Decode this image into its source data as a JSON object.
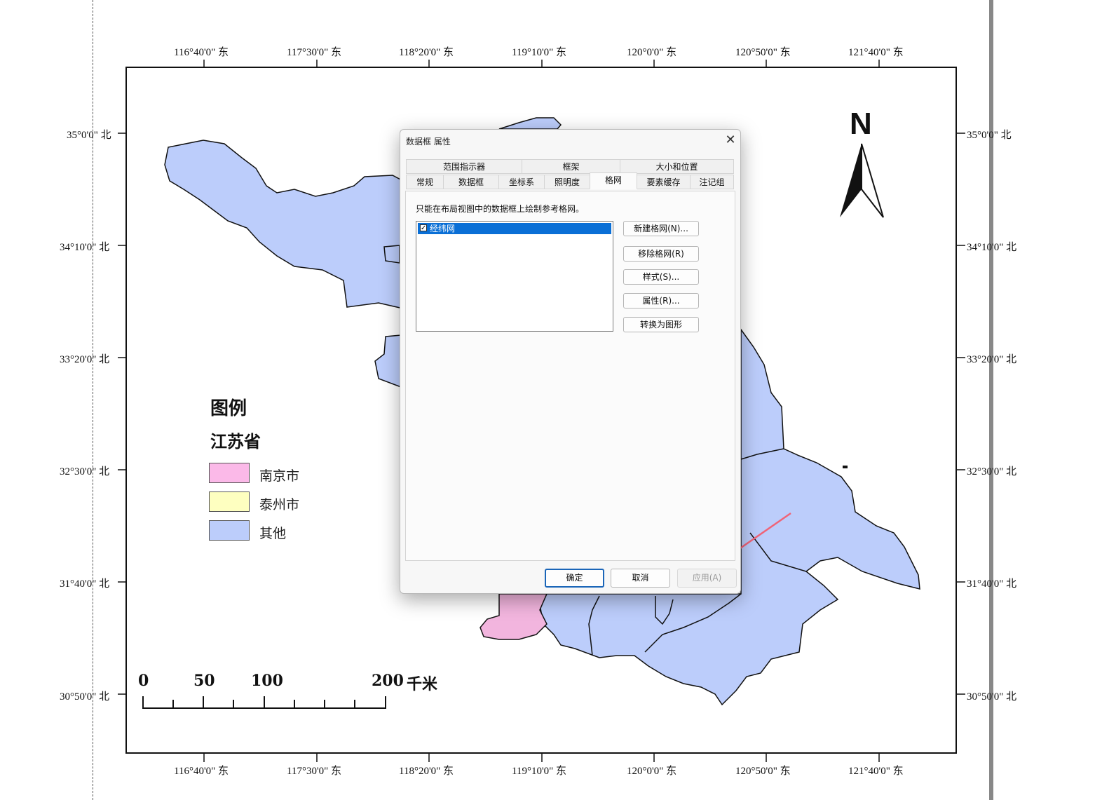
{
  "map": {
    "top_ticks": [
      "116°40'0\" 东",
      "117°30'0\" 东",
      "118°20'0\" 东",
      "119°10'0\" 东",
      "120°0'0\" 东",
      "120°50'0\" 东",
      "121°40'0\" 东"
    ],
    "bottom_ticks": [
      "116°40'0\" 东",
      "117°30'0\" 东",
      "118°20'0\" 东",
      "119°10'0\" 东",
      "120°0'0\" 东",
      "120°50'0\" 东",
      "121°40'0\" 东"
    ],
    "left_ticks": [
      "35°0'0\" 北",
      "34°10'0\" 北",
      "33°20'0\" 北",
      "32°30'0\" 北",
      "31°40'0\" 北",
      "30°50'0\" 北"
    ],
    "right_ticks": [
      "35°0'0\" 北",
      "34°10'0\" 北",
      "33°20'0\" 北",
      "32°30'0\" 北",
      "31°40'0\" 北",
      "30°50'0\" 北"
    ],
    "north_arrow": "N",
    "legend": {
      "title": "图例",
      "layer": "江苏省",
      "items": [
        {
          "label": "南京市",
          "color": "#fbb9e8"
        },
        {
          "label": "泰州市",
          "color": "#feffc0"
        },
        {
          "label": "其他",
          "color": "#bccdfb"
        }
      ]
    },
    "scale_bar": {
      "labels": [
        "0",
        "50",
        "100",
        "200"
      ],
      "unit": "千米"
    },
    "colors": {
      "other": "#bccdfb",
      "nanjing": "#f2b5de",
      "frame": "#111111"
    }
  },
  "dialog": {
    "title": "数据框 属性",
    "close_glyph": "✕",
    "tabs_row1": [
      "范围指示器",
      "框架",
      "大小和位置"
    ],
    "tabs_row2": [
      "常规",
      "数据框",
      "坐标系",
      "照明度",
      "格网",
      "要素缓存",
      "注记组"
    ],
    "active_tab": "格网",
    "description": "只能在布局视图中的数据框上绘制参考格网。",
    "grid_list": [
      {
        "label": "经纬网",
        "checked": true
      }
    ],
    "side_buttons": [
      "新建格网(N)...",
      "移除格网(R)",
      "样式(S)...",
      "属性(R)...",
      "转换为图形"
    ],
    "footer_buttons": {
      "ok": "确定",
      "cancel": "取消",
      "apply": "应用(A)"
    },
    "annotation_arrow_color": "#f06478"
  }
}
